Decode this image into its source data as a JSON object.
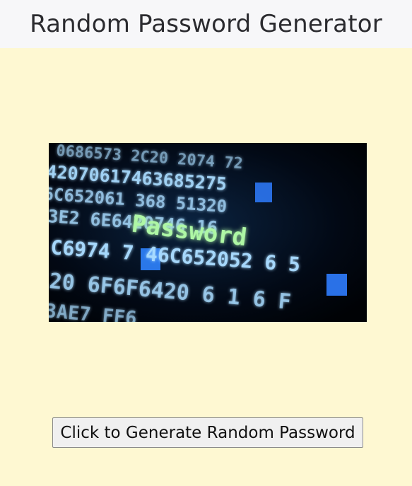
{
  "header": {
    "title": "Random Password Generator"
  },
  "hero_image": {
    "title_word": "Password",
    "rows": [
      "0686573 2C20 2074 72",
      "42070617463685275",
      "6C652061 368 51320",
      "3E2 6E6420746 16",
      "C6974 7 46C652052 6 5",
      "20 6F6F6420 6 1 6 F",
      "3AE7 FF6"
    ],
    "colors": {
      "background": "#02060d",
      "digits": "#a9dcff",
      "glow": "#3f9cff",
      "word": "#9cff9c",
      "highlight": "#1f7dff"
    }
  },
  "actions": {
    "generate_label": "Click to Generate Random Password"
  }
}
